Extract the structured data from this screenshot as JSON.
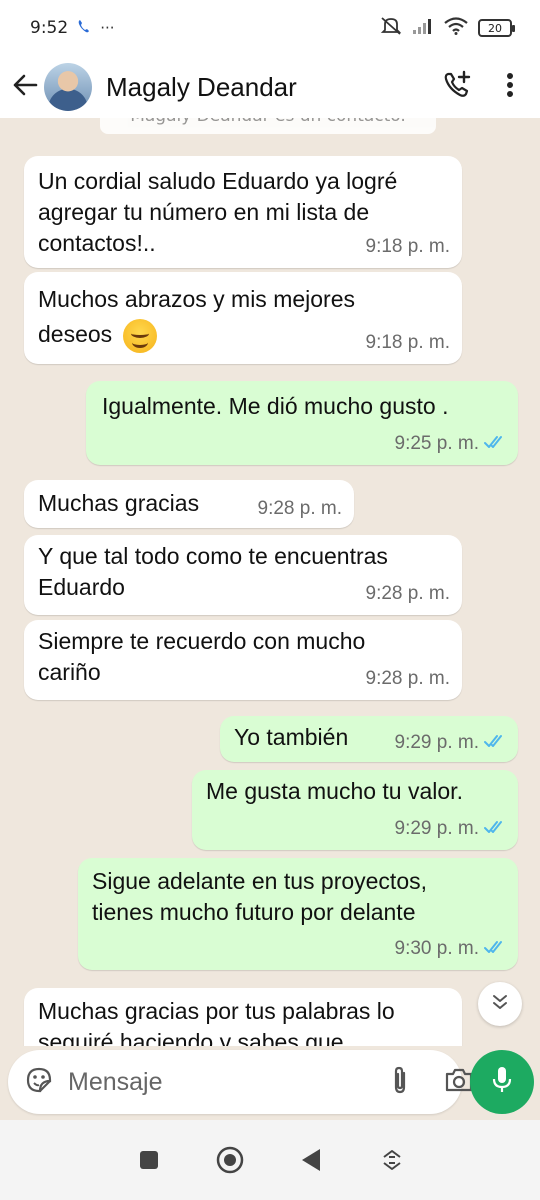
{
  "status_bar": {
    "time": "9:52",
    "battery": "20",
    "icons": [
      "phone-icon",
      "more-dots-icon",
      "mute-icon",
      "signal-icon",
      "wifi-icon",
      "battery-icon"
    ]
  },
  "header": {
    "contact_name": "Magaly Deandar",
    "icons": [
      "back-arrow-icon",
      "avatar",
      "add-call-icon",
      "overflow-menu-icon"
    ]
  },
  "chat": {
    "system_banner": "Magaly Deandar es un contacto.",
    "messages": [
      {
        "direction": "in",
        "text": "Un cordial saludo Eduardo ya logré agregar tu número en mi lista de contactos!..",
        "time": "9:18 p. m."
      },
      {
        "direction": "in",
        "text": "Muchos abrazos y mis mejores deseos",
        "emoji": "smiling-face-emoji",
        "time": "9:18 p. m."
      },
      {
        "direction": "out",
        "text": "Igualmente. Me dió mucho gusto .",
        "time": "9:25 p. m.",
        "status": "read"
      },
      {
        "direction": "in",
        "text": "Muchas gracias",
        "time": "9:28 p. m."
      },
      {
        "direction": "in",
        "text": "Y que tal todo como te encuentras Eduardo",
        "time": "9:28 p. m."
      },
      {
        "direction": "in",
        "text": "Siempre te recuerdo con mucho cariño",
        "time": "9:28 p. m."
      },
      {
        "direction": "out",
        "text": "Yo también",
        "time": "9:29 p. m.",
        "status": "read"
      },
      {
        "direction": "out",
        "text": "Me gusta mucho tu valor.",
        "time": "9:29 p. m.",
        "status": "read"
      },
      {
        "direction": "out",
        "text": "Sigue adelante en tus proyectos, tienes mucho futuro por delante",
        "time": "9:30 p. m.",
        "status": "read"
      },
      {
        "direction": "in",
        "text": "Muchas gracias por tus palabras lo seguiré haciendo y sabes que"
      }
    ]
  },
  "composer": {
    "placeholder": "Mensaje",
    "icons": [
      "sticker-icon",
      "attach-icon",
      "camera-icon",
      "mic-icon"
    ]
  },
  "nav": {
    "icons": [
      "recents-square-icon",
      "home-circle-icon",
      "back-triangle-icon",
      "rotate-icon"
    ]
  },
  "colors": {
    "wallpaper": "#efe7dd",
    "incoming_bubble": "#ffffff",
    "outgoing_bubble": "#d9fdd3",
    "accent_green": "#1daa61",
    "read_tick_blue": "#4fb6ec"
  }
}
